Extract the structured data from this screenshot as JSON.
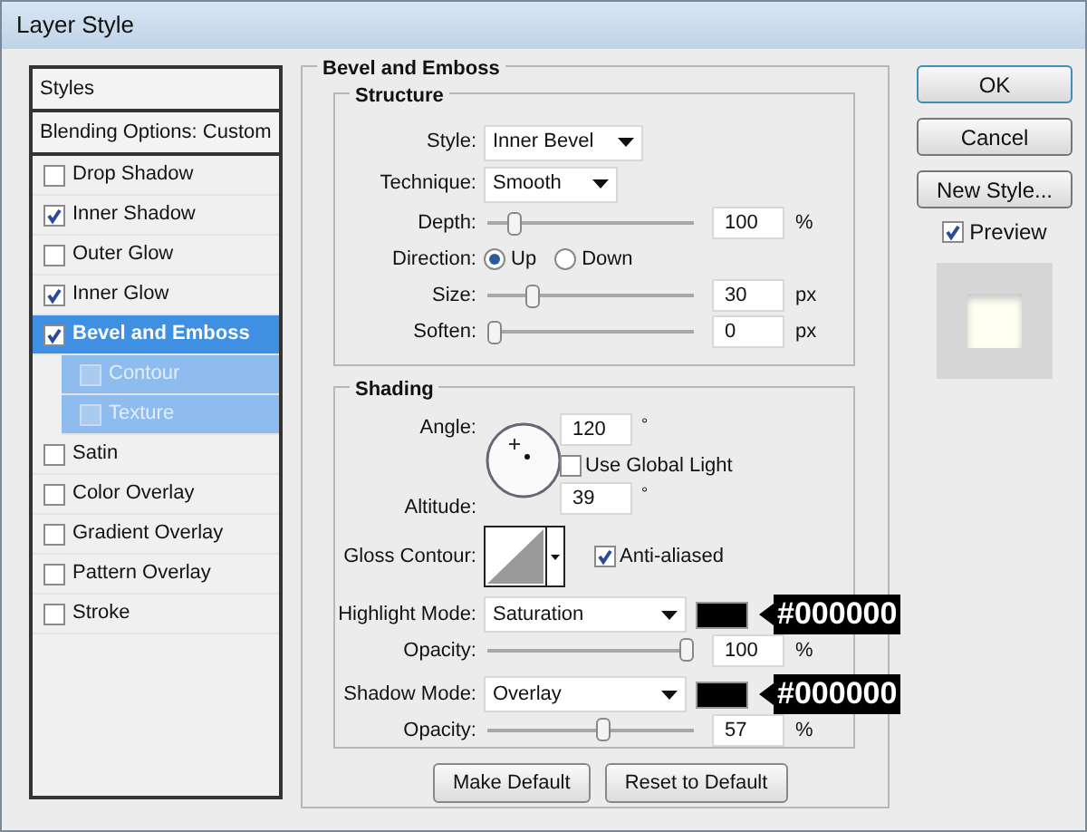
{
  "window": {
    "title": "Layer Style"
  },
  "sidebar": {
    "items": [
      {
        "label": "Styles",
        "kind": "header"
      },
      {
        "label": "Blending Options: Custom",
        "kind": "header"
      },
      {
        "label": "Drop Shadow",
        "kind": "effect",
        "checked": false,
        "selected": false
      },
      {
        "label": "Inner Shadow",
        "kind": "effect",
        "checked": true,
        "selected": false
      },
      {
        "label": "Outer Glow",
        "kind": "effect",
        "checked": false,
        "selected": false
      },
      {
        "label": "Inner Glow",
        "kind": "effect",
        "checked": true,
        "selected": false
      },
      {
        "label": "Bevel and Emboss",
        "kind": "effect",
        "checked": true,
        "selected": true
      },
      {
        "label": "Contour",
        "kind": "sub",
        "checked": false,
        "selected": false
      },
      {
        "label": "Texture",
        "kind": "sub",
        "checked": false,
        "selected": false
      },
      {
        "label": "Satin",
        "kind": "effect",
        "checked": false,
        "selected": false
      },
      {
        "label": "Color Overlay",
        "kind": "effect",
        "checked": false,
        "selected": false
      },
      {
        "label": "Gradient Overlay",
        "kind": "effect",
        "checked": false,
        "selected": false
      },
      {
        "label": "Pattern Overlay",
        "kind": "effect",
        "checked": false,
        "selected": false
      },
      {
        "label": "Stroke",
        "kind": "effect",
        "checked": false,
        "selected": false
      }
    ]
  },
  "panel": {
    "title": "Bevel and Emboss",
    "structure": {
      "title": "Structure",
      "rows": [
        {
          "kind": "dropdown",
          "label": "Style:",
          "value": "Inner Bevel"
        },
        {
          "kind": "dropdown",
          "label": "Technique:",
          "value": "Smooth"
        },
        {
          "kind": "slider",
          "label": "Depth:",
          "level": 0.1,
          "value": "100",
          "unit": "%"
        },
        {
          "kind": "radio",
          "label": "Direction:",
          "options": [
            {
              "label": "Up",
              "selected": true
            },
            {
              "label": "Down",
              "selected": false
            }
          ]
        },
        {
          "kind": "slider",
          "label": "Size:",
          "level": 0.2,
          "value": "30",
          "unit": "px"
        },
        {
          "kind": "slider",
          "label": "Soften:",
          "level": 0,
          "value": "0",
          "unit": "px"
        }
      ]
    },
    "shading": {
      "title": "Shading",
      "angle": {
        "label": "Angle:",
        "value": "120",
        "unit": "°"
      },
      "use_global_light": {
        "label": "Use Global Light",
        "checked": false
      },
      "altitude": {
        "label": "Altitude:",
        "value": "39",
        "unit": "°"
      },
      "gloss_contour": {
        "label": "Gloss Contour:"
      },
      "anti_aliased": {
        "label": "Anti-aliased",
        "checked": true
      },
      "rows": [
        {
          "kind": "mode",
          "label": "Highlight Mode:",
          "value": "Saturation",
          "color": "#000000",
          "annotation": "#000000"
        },
        {
          "kind": "slider",
          "label": "Opacity:",
          "level": 1,
          "value": "100",
          "unit": "%"
        },
        {
          "kind": "mode",
          "label": "Shadow Mode:",
          "value": "Overlay",
          "color": "#000000",
          "annotation": "#000000"
        },
        {
          "kind": "slider",
          "label": "Opacity:",
          "level": 0.57,
          "value": "57",
          "unit": "%"
        }
      ]
    },
    "buttons": [
      "Make Default",
      "Reset to Default"
    ]
  },
  "side_buttons": [
    {
      "label": "OK",
      "default": true
    },
    {
      "label": "Cancel",
      "default": false
    },
    {
      "label": "New Style...",
      "default": false
    }
  ],
  "preview": {
    "label": "Preview",
    "checked": true
  }
}
